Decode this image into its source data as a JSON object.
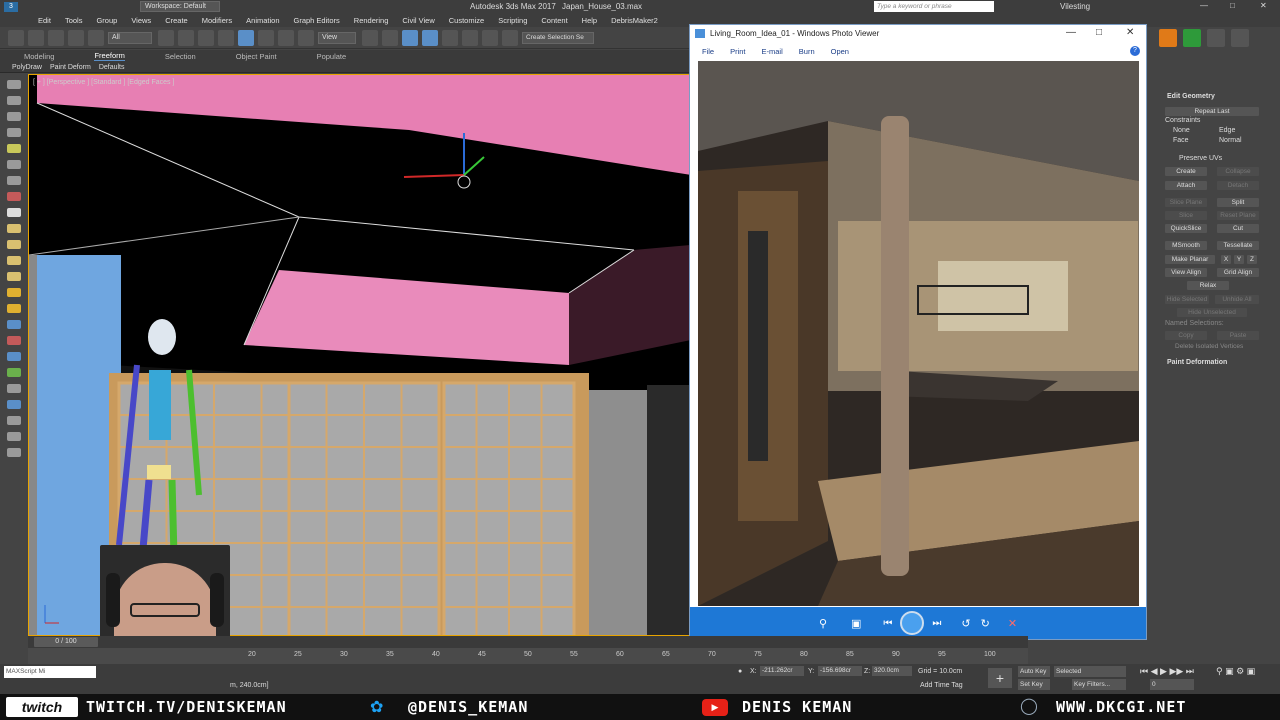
{
  "app": {
    "title": "Autodesk 3ds Max 2017",
    "file": "Japan_House_03.max",
    "workspace": "Workspace: Default",
    "search_placeholder": "Type a keyword or phrase",
    "user": "Vilesting"
  },
  "menu": [
    "Edit",
    "Tools",
    "Group",
    "Views",
    "Create",
    "Modifiers",
    "Animation",
    "Graph Editors",
    "Rendering",
    "Civil View",
    "Customize",
    "Scripting",
    "Content",
    "Help",
    "DebrisMaker2"
  ],
  "toolbar": {
    "filter": "All",
    "view_dropdown": "View",
    "selection_set": "Create Selection Se"
  },
  "ribbon": {
    "tabs": [
      "Modeling",
      "Freeform",
      "Selection",
      "Object Paint",
      "Populate"
    ],
    "sub": [
      "PolyDraw",
      "Paint Deform",
      "Defaults"
    ]
  },
  "viewport": {
    "label": "[ + ] [Perspective ] [Standard ] [Edged Faces ]"
  },
  "photo_viewer": {
    "title": "Living_Room_Idea_01 - Windows Photo Viewer",
    "menu": [
      "File",
      "Print",
      "E-mail",
      "Burn",
      "Open"
    ]
  },
  "command_panel": {
    "rollout": "Edit Geometry",
    "repeat_last": "Repeat Last",
    "constraints_label": "Constraints",
    "constraints": [
      "None",
      "Edge",
      "Face",
      "Normal"
    ],
    "preserve_uvs": "Preserve UVs",
    "buttons": [
      [
        "Create",
        "Collapse"
      ],
      [
        "Attach",
        "Detach"
      ],
      [
        "Slice Plane",
        "Split"
      ],
      [
        "Slice",
        "Reset Plane"
      ],
      [
        "QuickSlice",
        "Cut"
      ],
      [
        "MSmooth",
        "Tessellate"
      ],
      [
        "Make Planar",
        "X",
        "Y",
        "Z"
      ],
      [
        "View Align",
        "Grid Align"
      ],
      [
        "Relax"
      ],
      [
        "Hide Selected",
        "Unhide All"
      ],
      [
        "Hide Unselected"
      ],
      [
        "Named Selections:"
      ],
      [
        "Copy",
        "Paste"
      ],
      [
        "Delete Isolated Vertices"
      ]
    ],
    "paint_deformation": "Paint Deformation"
  },
  "timeline": {
    "frame": "0 / 100",
    "ticks": [
      "20",
      "25",
      "30",
      "35",
      "40",
      "45",
      "50",
      "55",
      "60",
      "65",
      "70",
      "75",
      "80",
      "85",
      "90",
      "95",
      "100"
    ]
  },
  "status": {
    "maxscript": "MAXScript Mi",
    "coord_suffix": "m, 240.0cm]",
    "x": "-211.262cr",
    "y": "-156.698cr",
    "z": "320.0cm",
    "grid": "Grid = 10.0cm",
    "add_time_tag": "Add Time Tag",
    "auto_key": "Auto Key",
    "set_key": "Set Key",
    "selected": "Selected",
    "key_filters": "Key Filters...",
    "frame_value": "0"
  },
  "banner": {
    "twitch": "TWITCH.TV/DENISKEMAN",
    "twitter": "@DENIS_KEMAN",
    "youtube": "DENIS KEMAN",
    "web": "WWW.DKCGI.NET"
  },
  "colors": {
    "ui_bg": "#444444",
    "accent_blue": "#5a8fc8",
    "viewer_bar": "#1e78d6",
    "pink": "#e77fb3",
    "viewport_border": "#e8a400"
  }
}
